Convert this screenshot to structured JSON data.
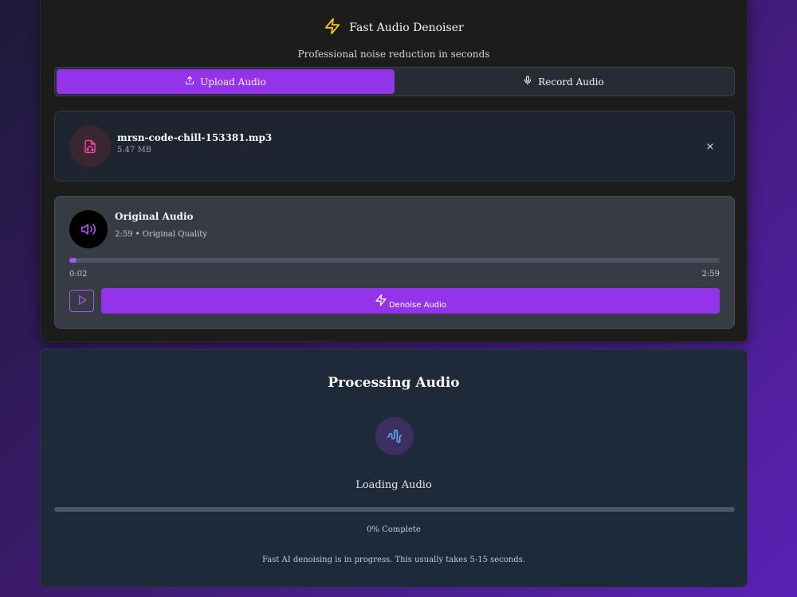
{
  "header": {
    "title": "Fast Audio Denoiser",
    "subtitle": "Professional noise reduction in seconds",
    "icon": "lightning-icon"
  },
  "tabs": [
    {
      "label": "Upload Audio",
      "icon": "upload-icon",
      "active": true
    },
    {
      "label": "Record Audio",
      "icon": "microphone-icon",
      "active": false
    }
  ],
  "file": {
    "name": "mrsn-code-chill-153381.mp3",
    "size": "5.47 MB",
    "icon": "audio-file-icon"
  },
  "player": {
    "title": "Original Audio",
    "meta": "2:59 • Original Quality",
    "current_time": "0:02",
    "total_time": "2:59",
    "progress_fraction": 0.011,
    "denoise_label": "Denoise Audio"
  },
  "processing": {
    "title": "Processing Audio",
    "status": "Loading Audio",
    "progress_fraction": 0,
    "percent_label": "0% Complete",
    "note": "Fast AI denoising is in progress. This usually takes 5-15 seconds."
  },
  "colors": {
    "accent": "#9333ea",
    "accent_light": "#a855f7",
    "file_icon": "#ec4899",
    "wave_icon": "#60a5fa",
    "lightning": "#facc15"
  }
}
